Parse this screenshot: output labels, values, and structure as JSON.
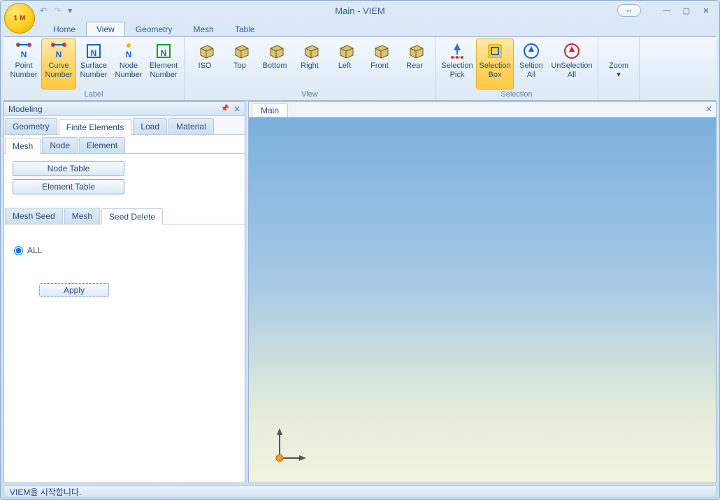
{
  "window": {
    "title": "Main - VIEM"
  },
  "menu": {
    "tabs": [
      "Home",
      "View",
      "Geometry",
      "Mesh",
      "Table"
    ],
    "active": 1
  },
  "ribbon": {
    "groups": [
      {
        "label": "Label",
        "items": [
          {
            "name": "point-number",
            "line1": "Point",
            "line2": "Number",
            "icon": "N-red"
          },
          {
            "name": "curve-number",
            "line1": "Curve",
            "line2": "Number",
            "icon": "N-yellow",
            "selected": true
          },
          {
            "name": "surface-number",
            "line1": "Surface",
            "line2": "Number",
            "icon": "N-box"
          },
          {
            "name": "node-number",
            "line1": "Node",
            "line2": "Number",
            "icon": "N-dot"
          },
          {
            "name": "element-number",
            "line1": "Element",
            "line2": "Number",
            "icon": "N-green"
          }
        ]
      },
      {
        "label": "View",
        "items": [
          {
            "name": "iso",
            "line1": "ISO",
            "line2": "",
            "icon": "cube"
          },
          {
            "name": "top",
            "line1": "Top",
            "line2": "",
            "icon": "cube"
          },
          {
            "name": "bottom",
            "line1": "Bottom",
            "line2": "",
            "icon": "cube"
          },
          {
            "name": "right",
            "line1": "Right",
            "line2": "",
            "icon": "cube"
          },
          {
            "name": "left",
            "line1": "Left",
            "line2": "",
            "icon": "cube"
          },
          {
            "name": "front",
            "line1": "Front",
            "line2": "",
            "icon": "cube"
          },
          {
            "name": "rear",
            "line1": "Rear",
            "line2": "",
            "icon": "cube"
          }
        ]
      },
      {
        "label": "Selection",
        "items": [
          {
            "name": "selection-pick",
            "line1": "Selection",
            "line2": "Pick",
            "icon": "pick"
          },
          {
            "name": "selection-box",
            "line1": "Selection",
            "line2": "Box",
            "icon": "selbox",
            "selected": true
          },
          {
            "name": "selection-all",
            "line1": "Seltion",
            "line2": "All",
            "icon": "selall"
          },
          {
            "name": "unselection-all",
            "line1": "UnSelection",
            "line2": "All",
            "icon": "unsel"
          }
        ]
      },
      {
        "label": "",
        "items": [
          {
            "name": "zoom",
            "line1": "Zoom",
            "line2": "▾",
            "icon": ""
          }
        ]
      }
    ]
  },
  "panel": {
    "title": "Modeling",
    "tabs1": [
      "Geometry",
      "Finite Elements",
      "Load",
      "Material"
    ],
    "tabs1_active": 1,
    "tabs2": [
      "Mesh",
      "Node",
      "Element"
    ],
    "tabs2_active": 0,
    "btn_node_table": "Node Table",
    "btn_element_table": "Element Table",
    "tabs3": [
      "Mesh Seed",
      "Mesh",
      "Seed Delete"
    ],
    "tabs3_active": 2,
    "radio_all": "ALL",
    "apply": "Apply"
  },
  "viewport": {
    "tab": "Main"
  },
  "status": {
    "text": "VIEM을 시작합니다."
  }
}
